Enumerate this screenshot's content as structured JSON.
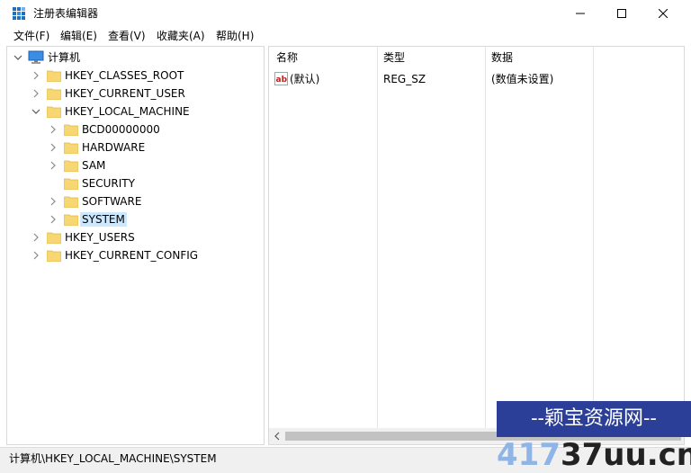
{
  "window": {
    "title": "注册表编辑器",
    "controls": {
      "minimize": "—",
      "maximize": "☐",
      "close": "✕"
    }
  },
  "menu": [
    "文件(F)",
    "编辑(E)",
    "查看(V)",
    "收藏夹(A)",
    "帮助(H)"
  ],
  "tree": {
    "root": "计算机",
    "hives": [
      "HKEY_CLASSES_ROOT",
      "HKEY_CURRENT_USER",
      "HKEY_LOCAL_MACHINE",
      "HKEY_USERS",
      "HKEY_CURRENT_CONFIG"
    ],
    "hklm_children": [
      "BCD00000000",
      "HARDWARE",
      "SAM",
      "SECURITY",
      "SOFTWARE",
      "SYSTEM"
    ],
    "selected": "SYSTEM"
  },
  "list": {
    "columns": [
      "名称",
      "类型",
      "数据"
    ],
    "rows": [
      {
        "icon": "ab",
        "name": "(默认)",
        "type": "REG_SZ",
        "data": "(数值未设置)"
      }
    ]
  },
  "status": {
    "path": "计算机\\HKEY_LOCAL_MACHINE\\SYSTEM"
  },
  "watermark": {
    "line1": "--颖宝资源网--",
    "line2_faint": "417",
    "line2_strong": "37uu.cn"
  },
  "colors": {
    "selection": "#cce8ff",
    "folder": "#f7d674",
    "watermark_bg": "#2b3f99"
  }
}
